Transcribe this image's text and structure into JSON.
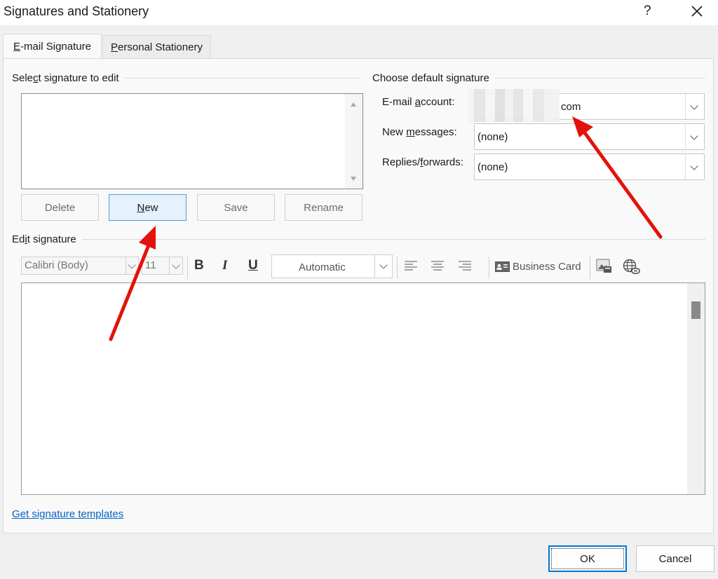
{
  "window": {
    "title": "Signatures and Stationery",
    "help_label": "?",
    "close_label": "✕"
  },
  "tabs": [
    {
      "prefix": "",
      "mnemonic": "E",
      "rest": "-mail Signature",
      "active": true
    },
    {
      "prefix": "",
      "mnemonic": "P",
      "rest": "ersonal Stationery",
      "active": false
    }
  ],
  "select_group": {
    "label_pre": "Sele",
    "label_mn": "c",
    "label_post": "t signature to edit"
  },
  "buttons": {
    "delete": "Delete",
    "new_mn": "N",
    "new_rest": "ew",
    "save": "Save",
    "rename": "Rename"
  },
  "default_group": {
    "label": "Choose default signature",
    "email_pre": "E-mail ",
    "email_mn": "a",
    "email_post": "ccount:",
    "email_value": "com",
    "new_pre": "New ",
    "new_mn": "m",
    "new_post": "essages:",
    "new_value": "(none)",
    "replies_pre": "Replies/",
    "replies_mn": "f",
    "replies_post": "orwards:",
    "replies_value": "(none)"
  },
  "edit_group": {
    "label_pre": "Ed",
    "label_mn": "i",
    "label_post": "t signature"
  },
  "toolbar": {
    "font": "Calibri (Body)",
    "size": "11",
    "bold": "B",
    "italic": "I",
    "underline": "U",
    "color": "Automatic",
    "business_card": "Business Card"
  },
  "link": "Get signature templates",
  "footer": {
    "ok": "OK",
    "cancel": "Cancel"
  },
  "colors": {
    "accent": "#0078d4",
    "arrow": "#e3120b",
    "link": "#0563c1"
  }
}
